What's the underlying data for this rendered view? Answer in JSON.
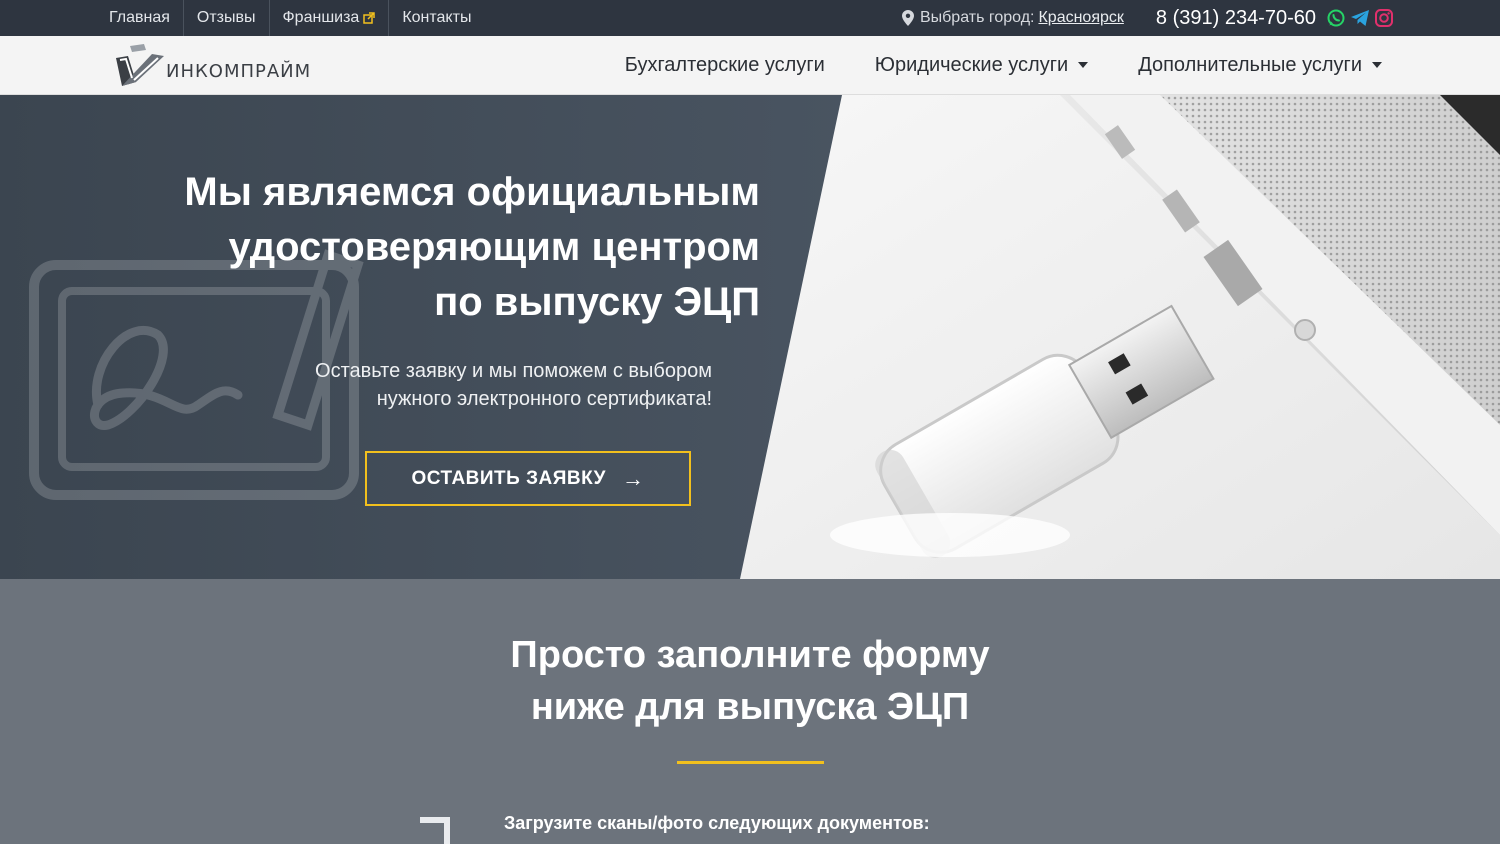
{
  "topbar": {
    "nav": [
      "Главная",
      "Отзывы",
      "Франшиза",
      "Контакты"
    ],
    "city_label": "Выбрать город:",
    "city_value": "Красноярск",
    "phone": "8 (391) 234-70-60",
    "icons": [
      "map-pin-icon",
      "whatsapp-icon",
      "telegram-icon",
      "instagram-icon",
      "external-link-icon"
    ]
  },
  "header": {
    "logo_text": "ИНКОМПРАЙМ",
    "nav": [
      "Бухгалтерские услуги",
      "Юридические услуги",
      "Дополнительные услуги"
    ]
  },
  "hero": {
    "title_line1": "Мы являемся официальным",
    "title_line2": "удостоверяющим центром",
    "title_line3": "по выпуску ЭЦП",
    "subtitle_line1": "Оставьте заявку и мы поможем с выбором",
    "subtitle_line2": "нужного электронного сертификата!",
    "button_label": "ОСТАВИТЬ ЗАЯВКУ",
    "button_arrow": "→"
  },
  "form_section": {
    "title_line1": "Просто заполните форму",
    "title_line2": "ниже для выпуска ЭЦП",
    "upload_label": "Загрузите сканы/фото следующих документов:"
  },
  "colors": {
    "topbar_bg": "#2e3540",
    "accent": "#f2c01d",
    "hero_bg": "#404a55",
    "form_bg": "#6c737c",
    "whatsapp": "#25d366",
    "telegram": "#2aa3df",
    "instagram": "#e1306c"
  }
}
